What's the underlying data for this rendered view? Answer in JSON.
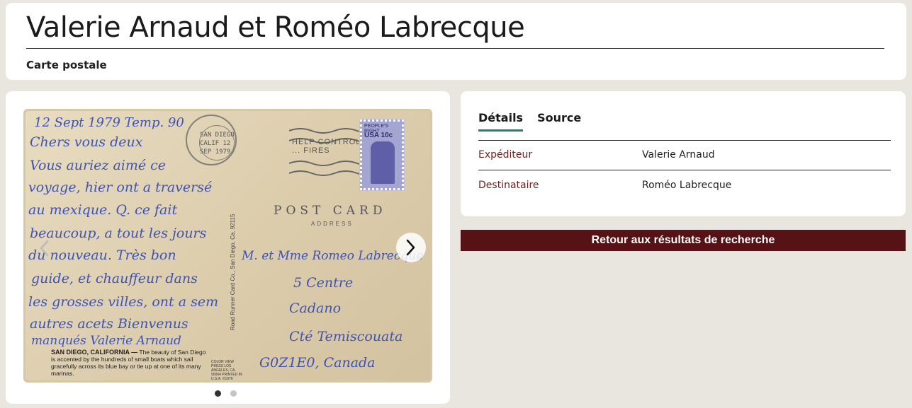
{
  "header": {
    "title": "Valerie Arnaud et Roméo Labrecque",
    "subtitle": "Carte postale"
  },
  "image": {
    "handwriting": [
      "12 Sept 1979 Temp. 90",
      "Chers vous deux",
      "Vous auriez aimé ce",
      "voyage, hier ont a traversé",
      "au mexique. Q. ce fait",
      "beaucoup, a tout les jours",
      "du nouveau. Très bon",
      "guide, et chauffeur dans",
      "les grosses villes, ont a sem",
      "autres acets Bienvenus",
      "manqués Valerie Arnaud"
    ],
    "address_lines": [
      "M. et Mme Romeo Labrecque",
      "5 Centre",
      "Cadano",
      "Cté Temiscouata",
      "G0Z1E0, Canada"
    ],
    "printed_postcard": "POST CARD",
    "printed_address": "ADDRESS",
    "caption_title": "SAN DIEGO, CALIFORNIA —",
    "caption_text": "The beauty of San Diego is accented by the hundreds of small boats which sail gracefully across its blue bay or tie up at one of its many marinas.",
    "vertical_print": "Road Runner Card Co., San Diego, Ca. 92115",
    "postmark_text": "SAN DIEGO CALIF 12 SEP 1979",
    "cancel_text": "HELP CONTROL ... FIRES",
    "stamp_text": "PEOPLE'S RIGHT",
    "stamp_value": "USA 10c",
    "colorview_text": "COLOR VIEW PRESS LOS ANGELES, CA. 90004 PRINTED IN U.S.A. ©1976",
    "dots_active_index": 0,
    "dot_count": 2
  },
  "details": {
    "tabs": [
      {
        "label": "Détails",
        "active": true
      },
      {
        "label": "Source",
        "active": false
      }
    ],
    "rows": [
      {
        "label": "Expéditeur",
        "value": "Valerie Arnaud"
      },
      {
        "label": "Destinataire",
        "value": "Roméo Labrecque"
      }
    ]
  },
  "back_button": {
    "label": "Retour aux résultats de recherche"
  },
  "colors": {
    "background": "#e9e6e0",
    "label_color": "#6e2222",
    "button_bg": "#561214",
    "tab_underline": "#2b7a6f",
    "handwriting_ink": "#3e53b4"
  }
}
